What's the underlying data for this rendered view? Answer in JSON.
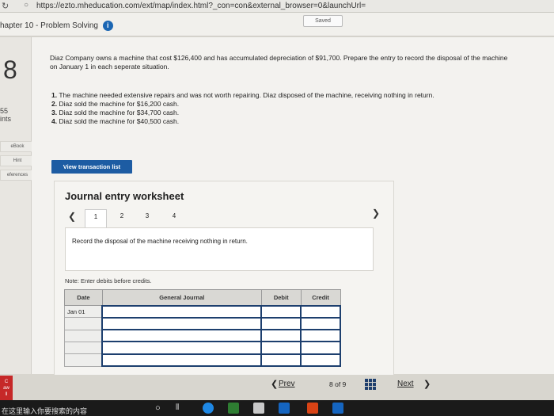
{
  "browser": {
    "url": "https://ezto.mheducation.com/ext/map/index.html?_con=con&external_browser=0&launchUrl="
  },
  "header": {
    "chapter_title": "hapter 10 - Problem Solving",
    "info_glyph": "i",
    "saved_label": "Saved"
  },
  "left_sidebar": {
    "question_number": "8",
    "points_value": "55",
    "points_label": "ints",
    "ebook_label": "eBook",
    "hint_label": "Hint",
    "references_label": "eferences"
  },
  "question": {
    "prompt": "Diaz Company owns a machine that cost $126,400 and has accumulated depreciation of $91,700. Prepare the entry to record the disposal of the machine on January 1 in each seperate situation.",
    "situations": [
      {
        "num": "1.",
        "text": "The machine needed extensive repairs and was not worth repairing. Diaz disposed of the machine, receiving nothing in return."
      },
      {
        "num": "2.",
        "text": "Diaz sold the machine for $16,200 cash."
      },
      {
        "num": "3.",
        "text": "Diaz sold the machine for $34,700 cash."
      },
      {
        "num": "4.",
        "text": "Diaz sold the machine for $40,500 cash."
      }
    ]
  },
  "view_transaction_button": "View transaction list",
  "worksheet": {
    "title": "Journal entry worksheet",
    "tabs": [
      "1",
      "2",
      "3",
      "4"
    ],
    "active_tab": "1",
    "instruction": "Record the disposal of the machine receiving nothing in return.",
    "note": "Note: Enter debits before credits.",
    "columns": {
      "date": "Date",
      "journal": "General Journal",
      "debit": "Debit",
      "credit": "Credit"
    },
    "rows": [
      {
        "date": "Jan 01",
        "account": "",
        "debit": "",
        "credit": ""
      },
      {
        "date": "",
        "account": "",
        "debit": "",
        "credit": ""
      },
      {
        "date": "",
        "account": "",
        "debit": "",
        "credit": ""
      },
      {
        "date": "",
        "account": "",
        "debit": "",
        "credit": ""
      },
      {
        "date": "",
        "account": "",
        "debit": "",
        "credit": ""
      }
    ]
  },
  "pagination": {
    "prev_label": "Prev",
    "page_text": "8 of 9",
    "next_label": "Next"
  },
  "red_tab_text": "C\naw\nll",
  "taskbar": {
    "search_placeholder": "在这里输入你要搜索的内容"
  },
  "colors": {
    "accent": "#1d5ca3",
    "table_border": "#1d3f6e"
  }
}
